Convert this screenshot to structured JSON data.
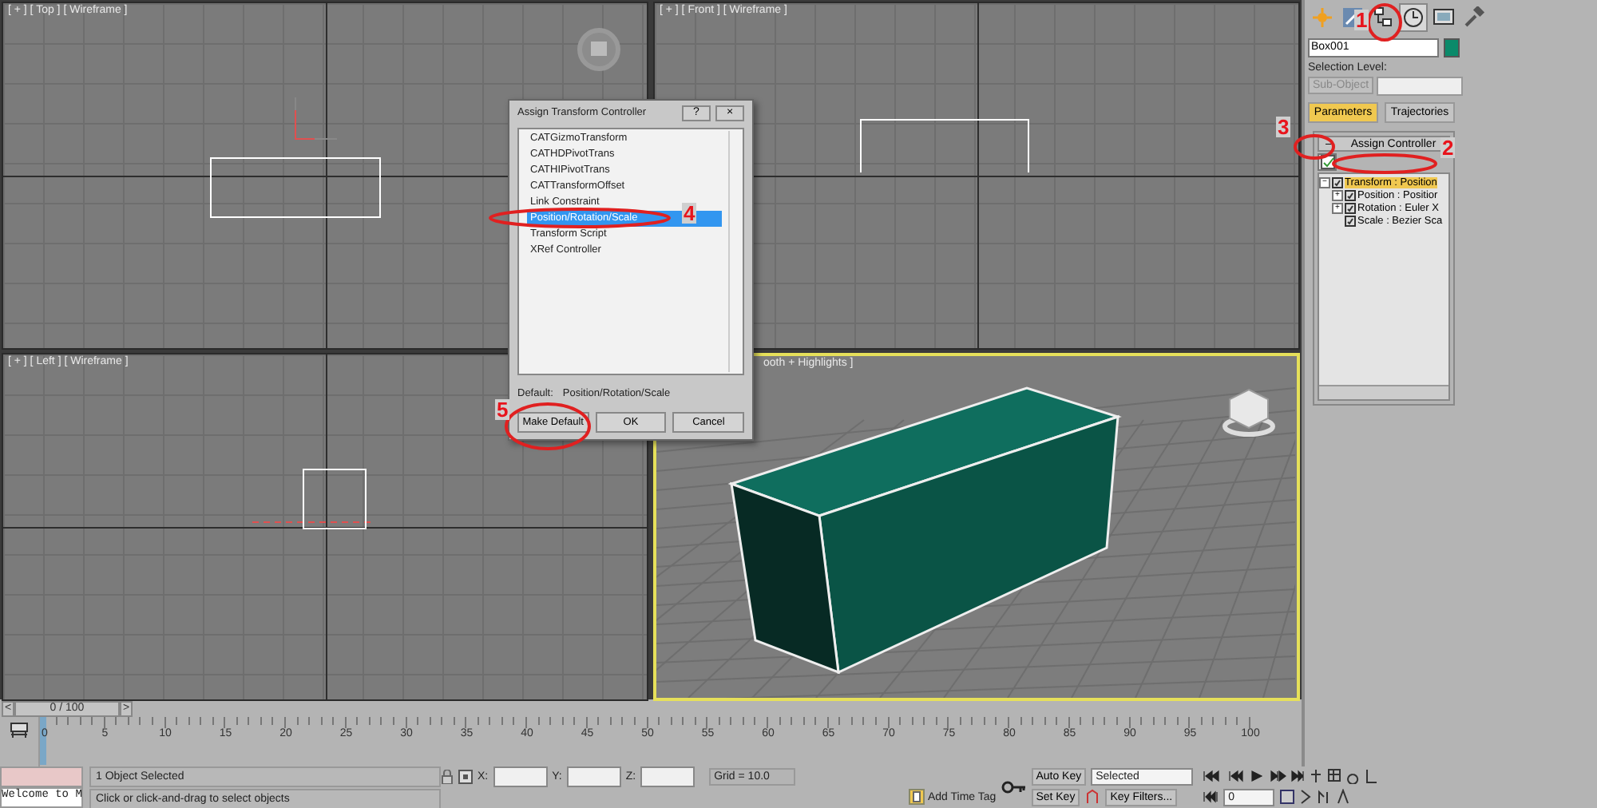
{
  "viewports": [
    {
      "label": "[ + ] [ Top ] [ Wireframe ]",
      "kind": "top",
      "active": false
    },
    {
      "label": "[ + ] [ Front ] [ Wireframe ]",
      "kind": "front",
      "active": false
    },
    {
      "label": "[ + ] [ Left ] [ Wireframe ]",
      "kind": "left",
      "active": false
    },
    {
      "label": "ooth + Highlights ]",
      "kind": "perspective",
      "active": true
    }
  ],
  "dialog": {
    "title": "Assign Transform Controller",
    "help": "?",
    "close": "×",
    "items": [
      {
        "label": "CATGizmoTransform",
        "selected": false
      },
      {
        "label": "CATHDPivotTrans",
        "selected": false
      },
      {
        "label": "CATHIPivotTrans",
        "selected": false
      },
      {
        "label": "CATTransformOffset",
        "selected": false
      },
      {
        "label": "Link Constraint",
        "selected": false
      },
      {
        "label": "Position/Rotation/Scale",
        "selected": true
      },
      {
        "label": "Transform Script",
        "selected": false
      },
      {
        "label": "XRef Controller",
        "selected": false
      }
    ],
    "default_label": "Default:",
    "default_value": "Position/Rotation/Scale",
    "buttons": [
      "Make Default",
      "OK",
      "Cancel"
    ]
  },
  "command_panel": {
    "tab_icons": [
      {
        "kind": "create",
        "selected": false
      },
      {
        "kind": "modify",
        "selected": false
      },
      {
        "kind": "hierarchy",
        "selected": false
      },
      {
        "kind": "motion",
        "selected": true
      },
      {
        "kind": "display",
        "selected": false
      },
      {
        "kind": "utilities",
        "selected": false
      }
    ],
    "object_name": "Box001",
    "selection_level": "Selection Level:",
    "sub_object": "Sub-Object",
    "tabs": [
      {
        "label": "Parameters",
        "selected": true
      },
      {
        "label": "Trajectories",
        "selected": false
      }
    ],
    "rollout": {
      "collapse": "–",
      "title": "Assign Controller"
    },
    "tree": [
      {
        "label": "Transform : Position",
        "toggle": "−",
        "selected": true,
        "children": [
          {
            "label": "Position : Positior",
            "toggle": "+",
            "selected": false
          },
          {
            "label": "Rotation : Euler X",
            "toggle": "+",
            "selected": false
          },
          {
            "label": "Scale : Bezier Sca",
            "selected": false
          }
        ]
      }
    ]
  },
  "time_slider": {
    "prev": "<",
    "reading": "0 / 100",
    "next": ">"
  },
  "ruler_labels": [
    "0",
    "5",
    "10",
    "15",
    "20",
    "25",
    "30",
    "35",
    "40",
    "45",
    "50",
    "55",
    "60",
    "65",
    "70",
    "75",
    "80",
    "85",
    "90",
    "95",
    "100"
  ],
  "status": {
    "listener": "Welcome to M",
    "selection": "1 Object Selected",
    "prompt": "Click or click-and-drag to select objects",
    "x_label": "X:",
    "y_label": "Y:",
    "z_label": "Z:",
    "grid": "Grid = 10.0",
    "time_tag": "Add Time Tag",
    "auto_key": "Auto Key",
    "key_mode": "Selected",
    "set_key": "Set Key",
    "key_filters": "Key Filters...",
    "frame": "0"
  },
  "annotations": [
    "1",
    "2",
    "3",
    "4",
    "5"
  ]
}
